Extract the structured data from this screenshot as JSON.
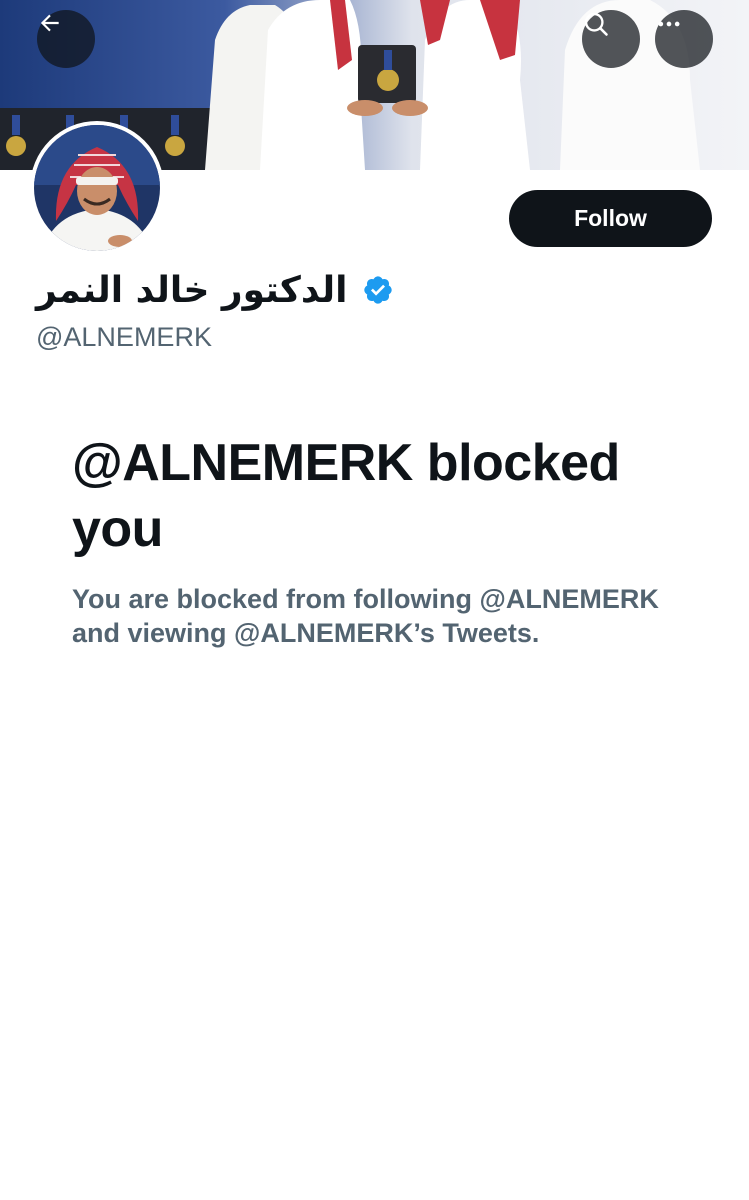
{
  "header": {
    "back_icon": "arrow-left-icon",
    "search_icon": "search-icon",
    "more_icon": "more-horizontal-icon"
  },
  "profile": {
    "display_name": "الدكتور خالد النمر",
    "verified_icon": "verified-badge-icon",
    "handle": "@ALNEMERK",
    "follow_label": "Follow"
  },
  "blocked": {
    "title": "@ALNEMERK blocked you",
    "message": "You are blocked from following @ALNEMERK and viewing @ALNEMERK’s Tweets."
  },
  "colors": {
    "accent_dark": "#0f1419",
    "secondary_text": "#536471",
    "verified_blue": "#1d9bf0"
  }
}
